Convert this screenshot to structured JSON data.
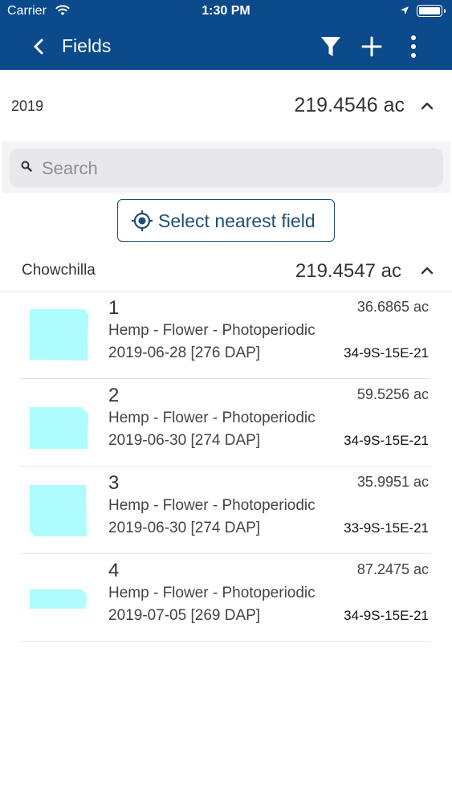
{
  "status_bar": {
    "carrier": "Carrier",
    "time": "1:30 PM"
  },
  "header": {
    "title": "Fields",
    "color": "#0b4a8b"
  },
  "season": {
    "label": "2019",
    "area": "219.4546 ac"
  },
  "search": {
    "placeholder": "Search",
    "value": ""
  },
  "nearest_button": {
    "label": "Select nearest field"
  },
  "farm": {
    "label": "Chowchilla",
    "area": "219.4547 ac"
  },
  "fields": [
    {
      "name": "1",
      "crop": "Hemp - Flower - Photoperiodic",
      "date": "2019-06-28 [276 DAP]",
      "area": "36.6865 ac",
      "legal": "34-9S-15E-21"
    },
    {
      "name": "2",
      "crop": "Hemp - Flower - Photoperiodic",
      "date": "2019-06-30 [274 DAP]",
      "area": "59.5256 ac",
      "legal": "34-9S-15E-21"
    },
    {
      "name": "3",
      "crop": "Hemp - Flower - Photoperiodic",
      "date": "2019-06-30 [274 DAP]",
      "area": "35.9951 ac",
      "legal": "33-9S-15E-21"
    },
    {
      "name": "4",
      "crop": "Hemp - Flower - Photoperiodic",
      "date": "2019-07-05 [269 DAP]",
      "area": "87.2475 ac",
      "legal": "34-9S-15E-21"
    }
  ],
  "icons": {
    "back": "back-arrow-icon",
    "filter": "filter-icon",
    "add": "plus-icon",
    "more": "more-vertical-icon",
    "chevron": "chevron-up-icon",
    "search": "search-icon",
    "locate": "crosshair-icon",
    "thumbnail_color": "#aefcfc"
  }
}
